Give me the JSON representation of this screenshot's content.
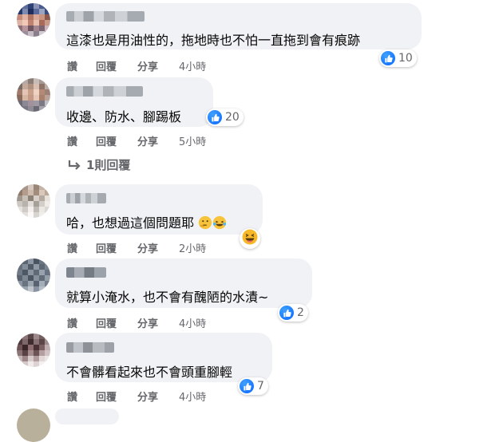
{
  "comments": [
    {
      "text": "這漆也是用油性的，拖地時也不怕一直拖到會有痕跡",
      "likes": "10",
      "actions": {
        "like": "讚",
        "reply": "回覆",
        "share": "分享",
        "time": "4小時"
      }
    },
    {
      "text": "收邊、防水、腳踢板",
      "likes": "20",
      "actions": {
        "like": "讚",
        "reply": "回覆",
        "share": "分享",
        "time": "5小時"
      }
    },
    {
      "text": "哈，也想過這個問題耶",
      "likes": "",
      "actions": {
        "like": "讚",
        "reply": "回覆",
        "share": "分享",
        "time": "2小時"
      }
    },
    {
      "text": "就算小淹水，也不會有醜陋的水漬~",
      "likes": "2",
      "actions": {
        "like": "讚",
        "reply": "回覆",
        "share": "分享",
        "time": "4小時"
      }
    },
    {
      "text": "不會髒看起來也不會頭重腳輕",
      "likes": "7",
      "actions": {
        "like": "讚",
        "reply": "回覆",
        "share": "分享",
        "time": "4小時"
      }
    }
  ],
  "replies_link": "1則回覆",
  "colors": {
    "bubble": "#f0f2f5",
    "like_blue": "#0866ff",
    "meta_gray": "#65676b"
  }
}
